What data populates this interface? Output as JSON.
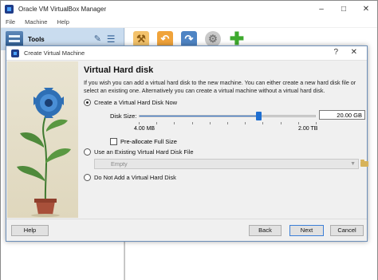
{
  "main_window": {
    "title": "Oracle VM VirtualBox Manager",
    "controls": {
      "minimize": "–",
      "maximize": "□",
      "close": "✕"
    },
    "menu": [
      "File",
      "Machine",
      "Help"
    ],
    "tools_label": "Tools",
    "toolbar_icons": [
      "wrench-icon",
      "import-icon",
      "export-icon",
      "gear-icon",
      "add-icon"
    ]
  },
  "dialog": {
    "title": "Create Virtual Machine",
    "help_glyph": "?",
    "close_glyph": "✕",
    "page_title": "Virtual Hard disk",
    "description": "If you wish you can add a virtual hard disk to the new machine. You can either create a new hard disk file or select an existing one. Alternatively you can create a virtual machine without a virtual hard disk.",
    "options": {
      "create_new": {
        "label": "Create a Virtual Hard Disk Now",
        "selected": true
      },
      "use_existing": {
        "label": "Use an Existing Virtual Hard Disk File",
        "selected": false
      },
      "no_disk": {
        "label": "Do Not Add a Virtual Hard Disk",
        "selected": false
      }
    },
    "disk_size": {
      "label": "Disk Size:",
      "value": "20.00 GB",
      "min_label": "4.00 MB",
      "max_label": "2.00 TB",
      "slider_fraction": 0.67
    },
    "preallocate": {
      "label": "Pre-allocate Full Size",
      "checked": false
    },
    "existing_select": {
      "value": "Empty"
    },
    "buttons": {
      "help": "Help",
      "back": "Back",
      "next": "Next",
      "cancel": "Cancel"
    }
  },
  "colors": {
    "accent": "#3c7fd7",
    "tools_header_bg": "#c9dcef",
    "illustration_bg": "#e6e0cb",
    "flower": "#2e6fb5",
    "leaves": "#4f8a3b",
    "pot": "#a8503a"
  }
}
